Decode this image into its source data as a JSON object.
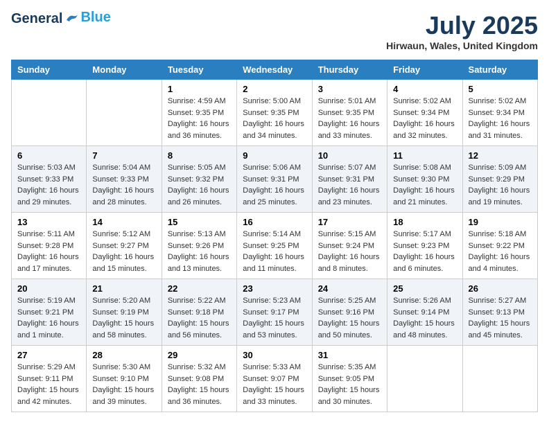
{
  "header": {
    "logo_general": "General",
    "logo_blue": "Blue",
    "month_year": "July 2025",
    "location": "Hirwaun, Wales, United Kingdom"
  },
  "weekdays": [
    "Sunday",
    "Monday",
    "Tuesday",
    "Wednesday",
    "Thursday",
    "Friday",
    "Saturday"
  ],
  "weeks": [
    [
      {
        "day": "",
        "info": ""
      },
      {
        "day": "",
        "info": ""
      },
      {
        "day": "1",
        "info": "Sunrise: 4:59 AM\nSunset: 9:35 PM\nDaylight: 16 hours\nand 36 minutes."
      },
      {
        "day": "2",
        "info": "Sunrise: 5:00 AM\nSunset: 9:35 PM\nDaylight: 16 hours\nand 34 minutes."
      },
      {
        "day": "3",
        "info": "Sunrise: 5:01 AM\nSunset: 9:35 PM\nDaylight: 16 hours\nand 33 minutes."
      },
      {
        "day": "4",
        "info": "Sunrise: 5:02 AM\nSunset: 9:34 PM\nDaylight: 16 hours\nand 32 minutes."
      },
      {
        "day": "5",
        "info": "Sunrise: 5:02 AM\nSunset: 9:34 PM\nDaylight: 16 hours\nand 31 minutes."
      }
    ],
    [
      {
        "day": "6",
        "info": "Sunrise: 5:03 AM\nSunset: 9:33 PM\nDaylight: 16 hours\nand 29 minutes."
      },
      {
        "day": "7",
        "info": "Sunrise: 5:04 AM\nSunset: 9:33 PM\nDaylight: 16 hours\nand 28 minutes."
      },
      {
        "day": "8",
        "info": "Sunrise: 5:05 AM\nSunset: 9:32 PM\nDaylight: 16 hours\nand 26 minutes."
      },
      {
        "day": "9",
        "info": "Sunrise: 5:06 AM\nSunset: 9:31 PM\nDaylight: 16 hours\nand 25 minutes."
      },
      {
        "day": "10",
        "info": "Sunrise: 5:07 AM\nSunset: 9:31 PM\nDaylight: 16 hours\nand 23 minutes."
      },
      {
        "day": "11",
        "info": "Sunrise: 5:08 AM\nSunset: 9:30 PM\nDaylight: 16 hours\nand 21 minutes."
      },
      {
        "day": "12",
        "info": "Sunrise: 5:09 AM\nSunset: 9:29 PM\nDaylight: 16 hours\nand 19 minutes."
      }
    ],
    [
      {
        "day": "13",
        "info": "Sunrise: 5:11 AM\nSunset: 9:28 PM\nDaylight: 16 hours\nand 17 minutes."
      },
      {
        "day": "14",
        "info": "Sunrise: 5:12 AM\nSunset: 9:27 PM\nDaylight: 16 hours\nand 15 minutes."
      },
      {
        "day": "15",
        "info": "Sunrise: 5:13 AM\nSunset: 9:26 PM\nDaylight: 16 hours\nand 13 minutes."
      },
      {
        "day": "16",
        "info": "Sunrise: 5:14 AM\nSunset: 9:25 PM\nDaylight: 16 hours\nand 11 minutes."
      },
      {
        "day": "17",
        "info": "Sunrise: 5:15 AM\nSunset: 9:24 PM\nDaylight: 16 hours\nand 8 minutes."
      },
      {
        "day": "18",
        "info": "Sunrise: 5:17 AM\nSunset: 9:23 PM\nDaylight: 16 hours\nand 6 minutes."
      },
      {
        "day": "19",
        "info": "Sunrise: 5:18 AM\nSunset: 9:22 PM\nDaylight: 16 hours\nand 4 minutes."
      }
    ],
    [
      {
        "day": "20",
        "info": "Sunrise: 5:19 AM\nSunset: 9:21 PM\nDaylight: 16 hours\nand 1 minute."
      },
      {
        "day": "21",
        "info": "Sunrise: 5:20 AM\nSunset: 9:19 PM\nDaylight: 15 hours\nand 58 minutes."
      },
      {
        "day": "22",
        "info": "Sunrise: 5:22 AM\nSunset: 9:18 PM\nDaylight: 15 hours\nand 56 minutes."
      },
      {
        "day": "23",
        "info": "Sunrise: 5:23 AM\nSunset: 9:17 PM\nDaylight: 15 hours\nand 53 minutes."
      },
      {
        "day": "24",
        "info": "Sunrise: 5:25 AM\nSunset: 9:16 PM\nDaylight: 15 hours\nand 50 minutes."
      },
      {
        "day": "25",
        "info": "Sunrise: 5:26 AM\nSunset: 9:14 PM\nDaylight: 15 hours\nand 48 minutes."
      },
      {
        "day": "26",
        "info": "Sunrise: 5:27 AM\nSunset: 9:13 PM\nDaylight: 15 hours\nand 45 minutes."
      }
    ],
    [
      {
        "day": "27",
        "info": "Sunrise: 5:29 AM\nSunset: 9:11 PM\nDaylight: 15 hours\nand 42 minutes."
      },
      {
        "day": "28",
        "info": "Sunrise: 5:30 AM\nSunset: 9:10 PM\nDaylight: 15 hours\nand 39 minutes."
      },
      {
        "day": "29",
        "info": "Sunrise: 5:32 AM\nSunset: 9:08 PM\nDaylight: 15 hours\nand 36 minutes."
      },
      {
        "day": "30",
        "info": "Sunrise: 5:33 AM\nSunset: 9:07 PM\nDaylight: 15 hours\nand 33 minutes."
      },
      {
        "day": "31",
        "info": "Sunrise: 5:35 AM\nSunset: 9:05 PM\nDaylight: 15 hours\nand 30 minutes."
      },
      {
        "day": "",
        "info": ""
      },
      {
        "day": "",
        "info": ""
      }
    ]
  ]
}
